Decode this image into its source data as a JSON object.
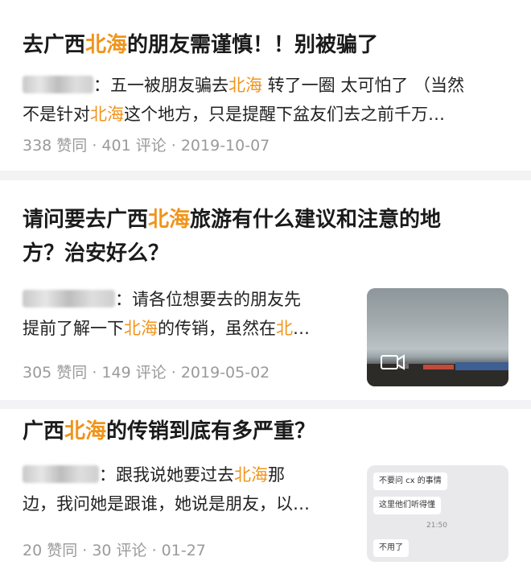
{
  "posts": [
    {
      "title_pre": "去广西",
      "title_hl": "北海",
      "title_post": "的朋友需谨慎！！别被骗了",
      "line1_a": "：五一被朋友骗去",
      "line1_hl": "北海",
      "line1_b": " 转了一圈 太可怕了 （当然",
      "line2_a": "不是针对",
      "line2_hl": "北海",
      "line2_b": "这个地方，只是提醒下盆友们去之前千万…",
      "meta": "338 赞同 · 401 评论 · 2019-10-07"
    },
    {
      "title_l1_pre": "请问要去广西",
      "title_l1_hl": "北海",
      "title_l1_post": "旅游有什么建议和注意的地",
      "title_l2": "方？治安好么？",
      "line1": "：请各位想要去的朋友先",
      "line2_a": "提前了解一下",
      "line2_hl": "北海",
      "line2_b": "的传销，虽然在",
      "line2_hl2": "北",
      "line2_c": "…",
      "meta": "305 赞同 · 149 评论 · 2019-05-02"
    },
    {
      "title_pre": "广西",
      "title_hl": "北海",
      "title_post": "的传销到底有多严重？",
      "line1_a": "：跟我说她要过去",
      "line1_hl": "北海",
      "line1_b": "那",
      "line2": "边，我问她是跟谁，她说是朋友，以…",
      "meta": "20 赞同 · 30 评论 · 01-27",
      "chat": {
        "msg1": "不要问 cx 的事情",
        "msg2": "这里他们听得懂",
        "time": "21:50",
        "msg3": "不用了"
      }
    }
  ],
  "colors": {
    "highlight": "#f0941c",
    "meta": "#9a9a9a",
    "background": "#f3f3f5"
  },
  "icons": {
    "video": "video-camera-icon"
  }
}
